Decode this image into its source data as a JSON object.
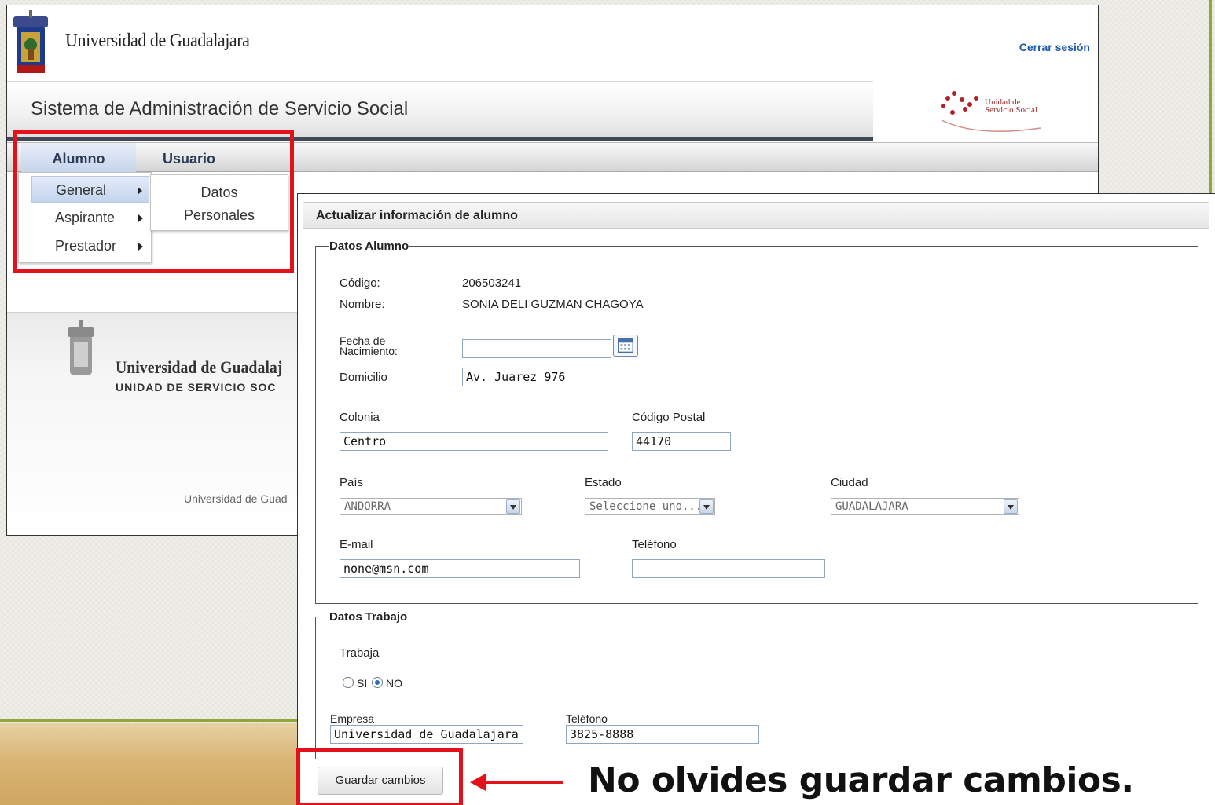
{
  "header": {
    "university_name": "Universidad de Guadalajara",
    "logout_label": "Cerrar sesión",
    "system_title": "Sistema de Administración de Servicio Social",
    "uss_logo_text_1": "Unidad de",
    "uss_logo_text_2": "Servicio Social"
  },
  "menu": {
    "top": [
      "Alumno",
      "Usuario"
    ],
    "dropdown": [
      "General",
      "Aspirante",
      "Prestador"
    ],
    "submenu": [
      "Datos",
      "Personales"
    ]
  },
  "footer": {
    "university_name": "Universidad de Guadalaj",
    "unit_name": "UNIDAD DE SERVICIO SOC",
    "copyright": "Universidad de Guad"
  },
  "form": {
    "title": "Actualizar información de alumno",
    "datos_alumno": {
      "legend": "Datos Alumno",
      "codigo_label": "Código:",
      "codigo_value": "206503241",
      "nombre_label": "Nombre:",
      "nombre_value": "SONIA DELI GUZMAN CHAGOYA",
      "fecha_label_1": "Fecha de",
      "fecha_label_2": "Nacimiento:",
      "fecha_value": "",
      "domicilio_label": "Domicilio",
      "domicilio_value": "Av. Juarez 976",
      "colonia_label": "Colonia",
      "colonia_value": "Centro",
      "cp_label": "Código Postal",
      "cp_value": "44170",
      "pais_label": "País",
      "pais_value": "ANDORRA",
      "estado_label": "Estado",
      "estado_value": "Seleccione uno...",
      "ciudad_label": "Ciudad",
      "ciudad_value": "GUADALAJARA",
      "email_label": "E-mail",
      "email_value": "none@msn.com",
      "telefono_label": "Teléfono",
      "telefono_value": ""
    },
    "datos_trabajo": {
      "legend": "Datos Trabajo",
      "trabaja_label": "Trabaja",
      "radio_si": "SI",
      "radio_no": "NO",
      "selected": "NO",
      "empresa_label": "Empresa",
      "empresa_value": "Universidad de Guadalajara",
      "telefono_label": "Teléfono",
      "telefono_value": "3825-8888"
    },
    "save_label": "Guardar cambios"
  },
  "annotation": {
    "reminder": "No olvides guardar cambios."
  },
  "colors": {
    "highlight_red": "#e4111a",
    "link_blue": "#1c5aa8",
    "accent_green": "#8fa63a"
  }
}
